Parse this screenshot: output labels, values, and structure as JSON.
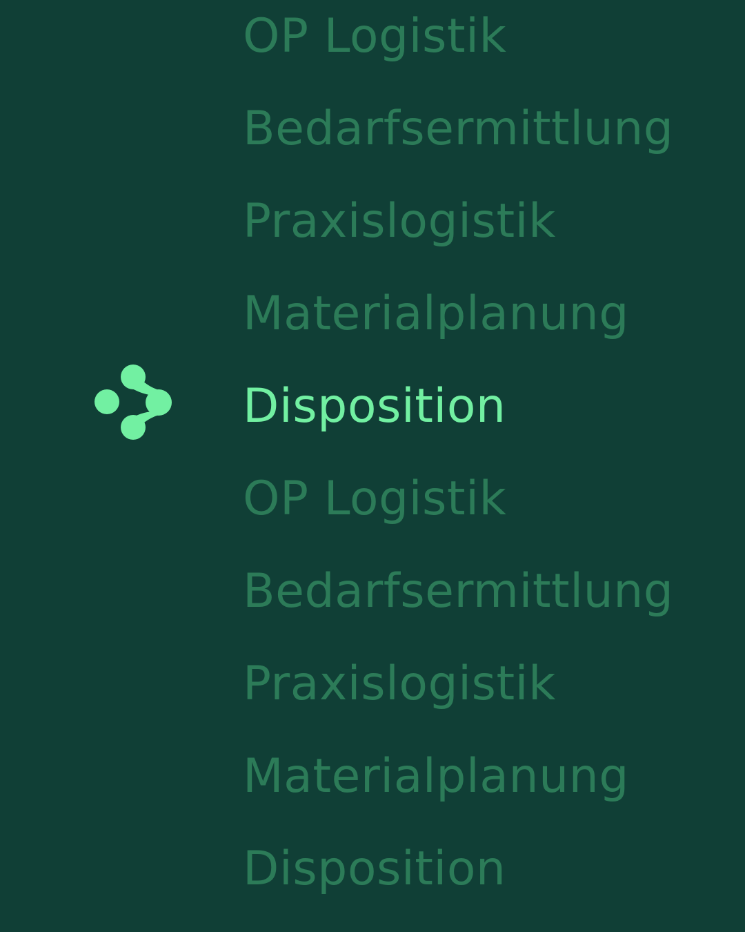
{
  "colors": {
    "background": "#103f36",
    "item_dim": "#2c7b58",
    "item_active": "#72f0a2"
  },
  "picker": {
    "selected_index": 4,
    "indicator_icon": "arrow-node-icon",
    "items": [
      {
        "label": "OP Logistik"
      },
      {
        "label": "Bedarfsermittlung"
      },
      {
        "label": "Praxislogistik"
      },
      {
        "label": "Materialplanung"
      },
      {
        "label": "Disposition"
      },
      {
        "label": "OP Logistik"
      },
      {
        "label": "Bedarfsermittlung"
      },
      {
        "label": "Praxislogistik"
      },
      {
        "label": "Materialplanung"
      },
      {
        "label": "Disposition"
      }
    ]
  }
}
